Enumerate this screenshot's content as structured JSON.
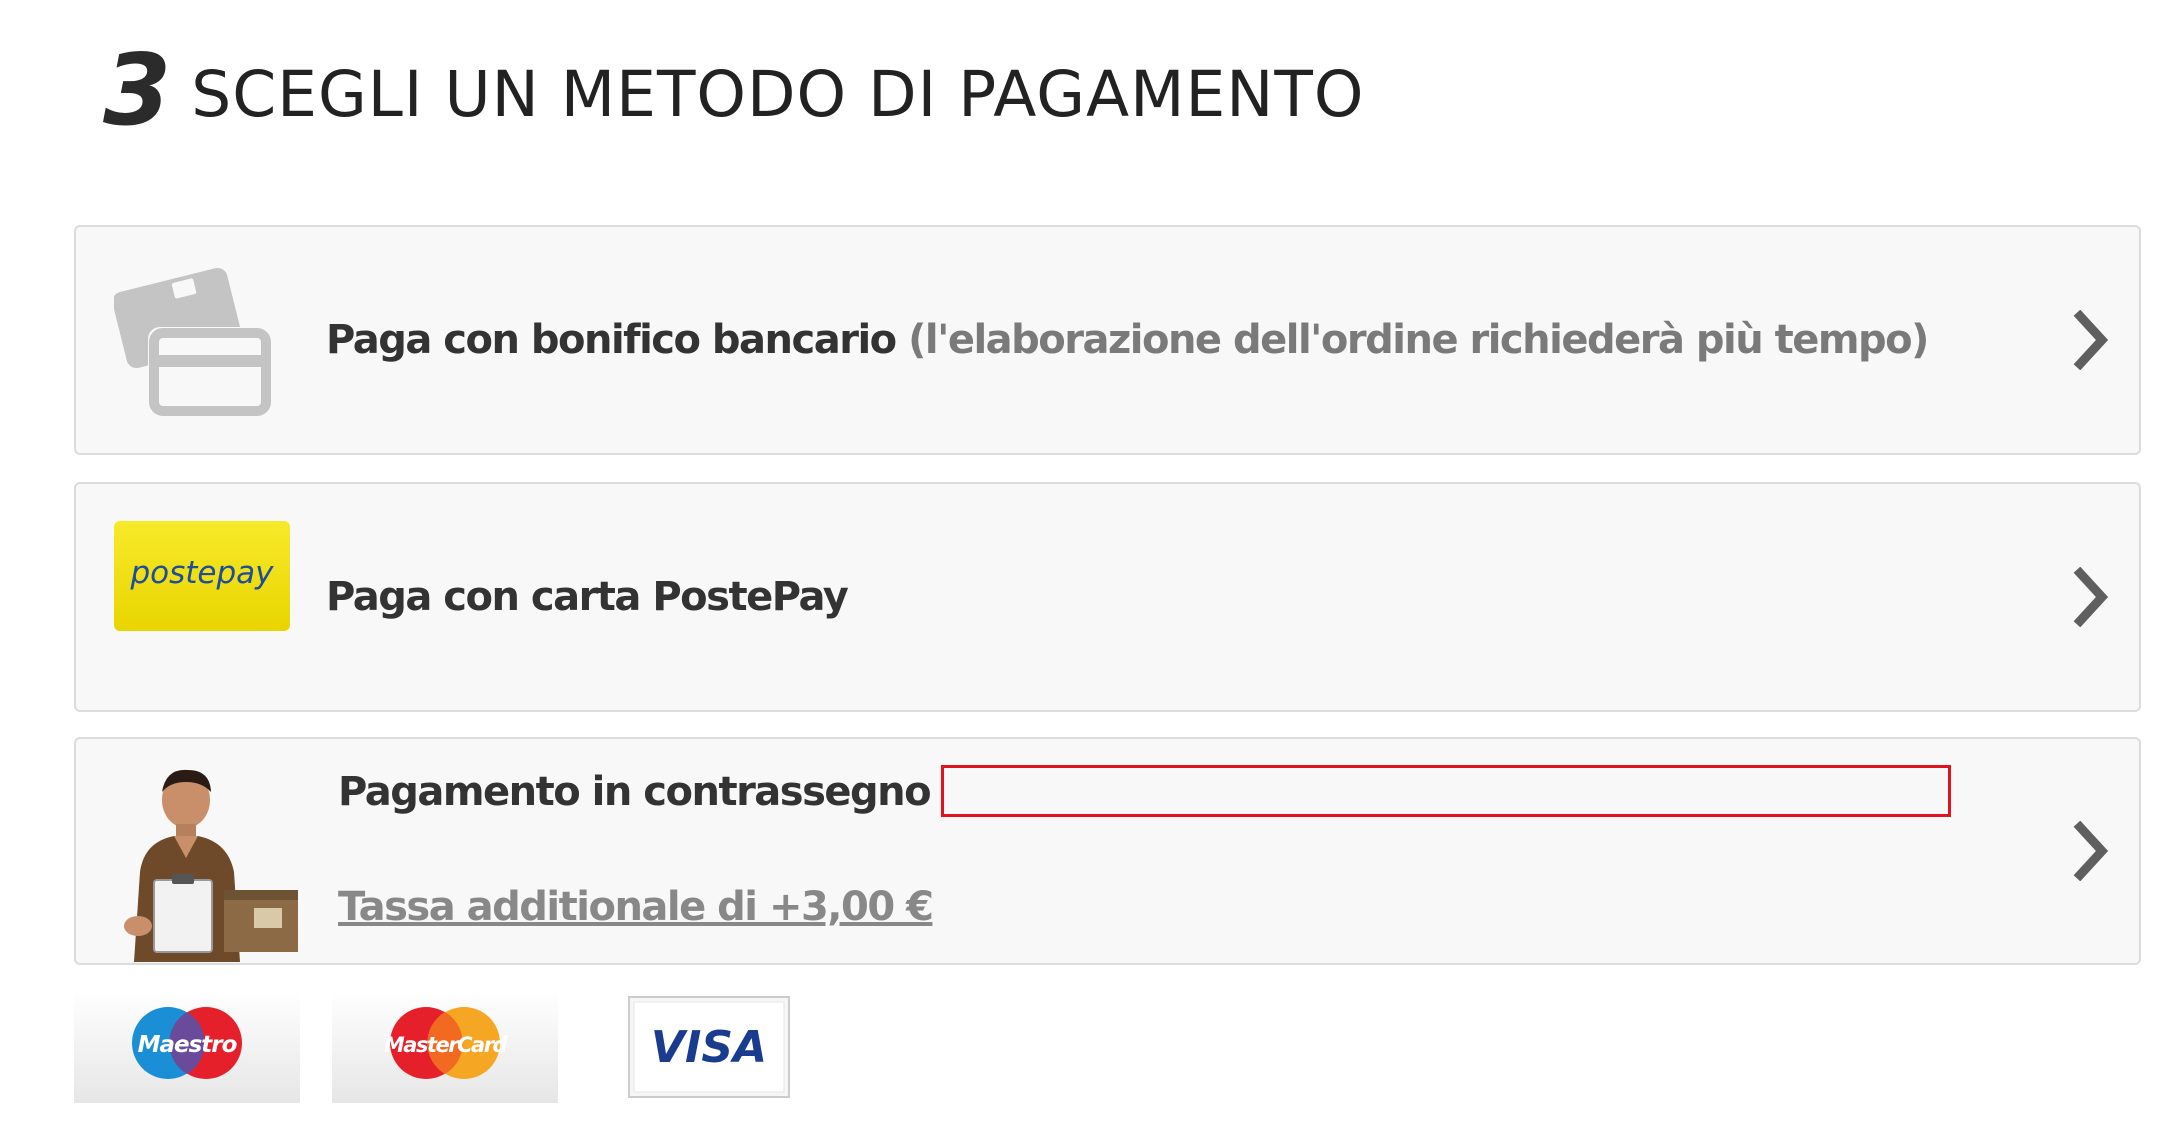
{
  "header": {
    "step_number": "3",
    "title": "SCEGLI UN METODO DI PAGAMENTO"
  },
  "payment_options": {
    "bank_transfer": {
      "label": "Paga con bonifico bancario",
      "note": "(l'elaborazione dell'ordine richiederà più tempo)",
      "icon": "credit-card-icon"
    },
    "postepay": {
      "label": "Paga con carta PostePay",
      "logo_text": "postepay",
      "logo_color": "#f5e400"
    },
    "cash_on_delivery": {
      "label": "Pagamento in contrassegno",
      "fee_label": "Tassa additionale di +3,00 €",
      "icon": "courier-person-icon"
    }
  },
  "card_logos": {
    "maestro": "Maestro",
    "mastercard": "MasterCard",
    "visa": "VISA"
  },
  "colors": {
    "highlight_border": "#e0141e",
    "option_bg": "#f8f8f8",
    "option_border": "#dcdcdc",
    "note_text": "#7a7a7a"
  }
}
